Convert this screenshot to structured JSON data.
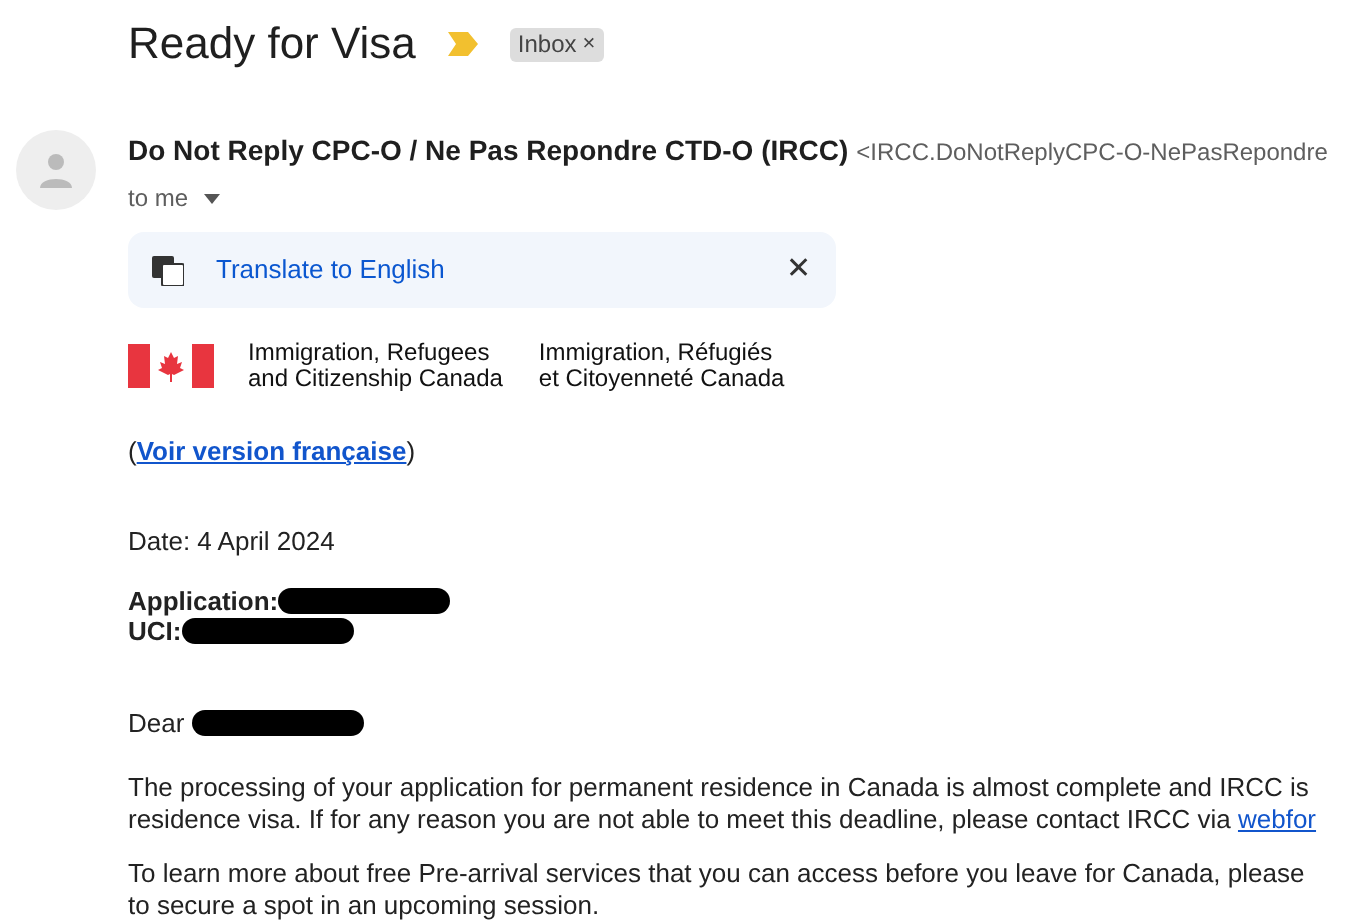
{
  "subject": {
    "title": "Ready for Visa",
    "important": true,
    "label": "Inbox",
    "label_close": "×"
  },
  "sender": {
    "name": "Do Not Reply CPC-O / Ne Pas Repondre CTD-O (IRCC)",
    "email": "<IRCC.DoNotReplyCPC-O-NePasRepondre",
    "recipient": "to me"
  },
  "translate_bar": {
    "label": "Translate to English",
    "close": "✕"
  },
  "signature": {
    "english": [
      "Immigration, Refugees",
      "and Citizenship Canada"
    ],
    "french": [
      "Immigration, Réfugiés",
      "et Citoyenneté Canada"
    ]
  },
  "language_link": {
    "before": "(",
    "link": "Voir version française",
    "after": ")"
  },
  "body": {
    "date": "Date: 4 April 2024",
    "fields": [
      {
        "label": "Application:",
        "redacted": true
      },
      {
        "label": "UCI:",
        "redacted": true
      }
    ],
    "greeting": {
      "text": "Dear",
      "redacted": true
    },
    "paragraphs": [
      {
        "lines": [
          "The processing of your application for permanent residence in Canada is almost complete and IRCC is",
          "residence visa. If for any reason you are not able to meet this deadline, please contact IRCC via"
        ],
        "link": "webfor"
      },
      {
        "lines": [
          "To learn more about free Pre-arrival services that you can access before you leave for Canada, please",
          "to secure a spot in an upcoming session."
        ]
      }
    ]
  }
}
